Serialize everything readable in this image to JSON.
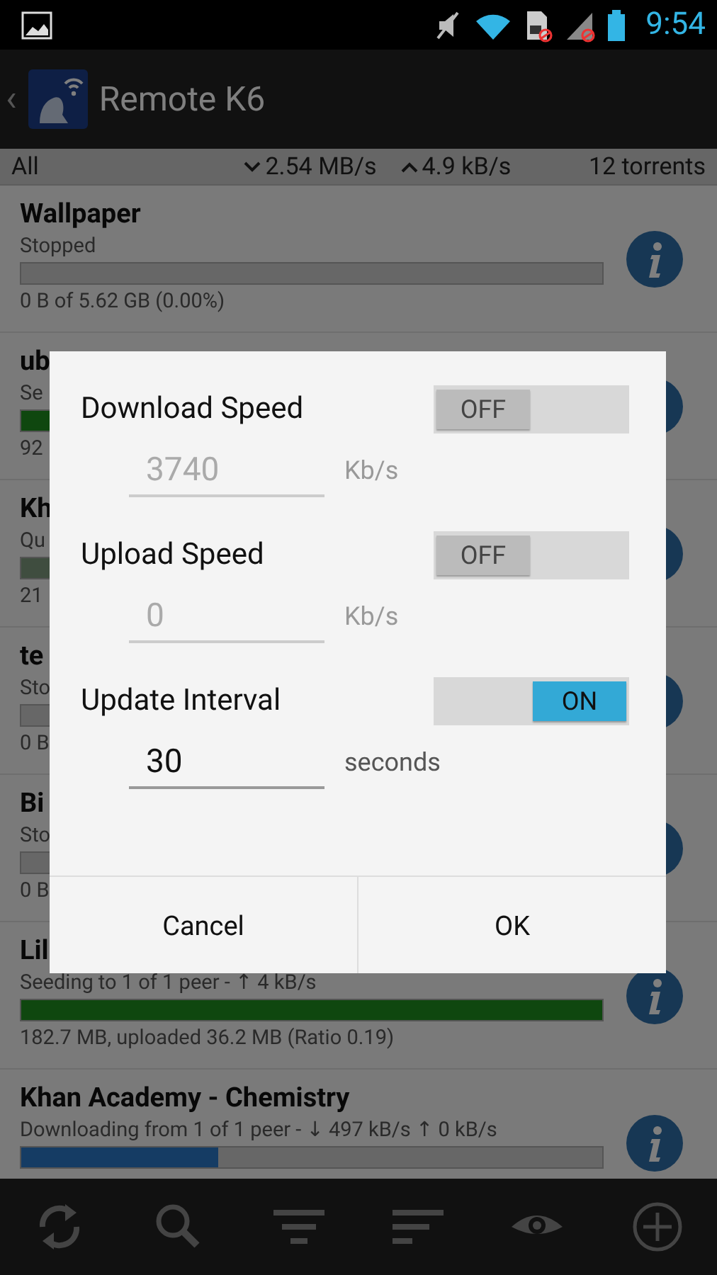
{
  "status_bar": {
    "time": "9:54"
  },
  "action_bar": {
    "back": "‹",
    "title": "Remote K6"
  },
  "summary": {
    "filter": "All",
    "download": "2.54 MB/s",
    "upload": "4.9 kB/s",
    "count": "12 torrents"
  },
  "torrents": [
    {
      "name": "Wallpaper",
      "status": "Stopped",
      "kind": "stopped",
      "level": 0,
      "details": "0 B of 5.62 GB (0.00%)"
    },
    {
      "name": "ub",
      "status": "Se",
      "kind": "seeding",
      "level": 1,
      "details": "92"
    },
    {
      "name": "Kh",
      "status": "Qu",
      "kind": "queued",
      "level": 1,
      "details": "21"
    },
    {
      "name": "te",
      "status": "Sto",
      "kind": "stopped",
      "level": 0,
      "details": "0 B"
    },
    {
      "name": "Bi",
      "status": "Sto",
      "kind": "stopped",
      "level": 0,
      "details": "0 B"
    },
    {
      "name": "Lil",
      "status": "Seeding to 1 of 1 peer - ↑ 4 kB/s",
      "kind": "seeding",
      "level": 1,
      "details": "182.7 MB, uploaded 36.2 MB (Ratio 0.19)"
    },
    {
      "name": "Khan Academy - Chemistry",
      "status": "Downloading from 1 of 1 peer - ↓ 497 kB/s ↑ 0 kB/s",
      "kind": "downloading",
      "level": 0.34
    }
  ],
  "dialog": {
    "settings": [
      {
        "label": "Download Speed",
        "switch": "OFF",
        "on": false,
        "value": "3740",
        "unit": "Kb/s",
        "disabled": true
      },
      {
        "label": "Upload Speed",
        "switch": "OFF",
        "on": false,
        "value": "0",
        "unit": "Kb/s",
        "disabled": true
      },
      {
        "label": "Update Interval",
        "switch": "ON",
        "on": true,
        "value": "30",
        "unit": "seconds",
        "disabled": false
      }
    ],
    "buttons": [
      "Cancel",
      "OK"
    ]
  },
  "toolbar": [
    {
      "kind": "refresh"
    },
    {
      "kind": "search"
    },
    {
      "kind": "filter"
    },
    {
      "kind": "sort"
    },
    {
      "kind": "view"
    },
    {
      "kind": "add"
    }
  ]
}
